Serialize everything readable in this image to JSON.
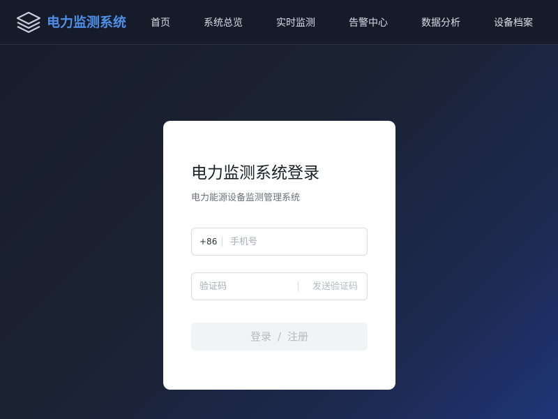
{
  "header": {
    "brand": "电力监测系统",
    "logo_icon": "stacked-layers-icon",
    "brand_color": "#4e8fe8",
    "nav": [
      {
        "label": "首页"
      },
      {
        "label": "系统总览"
      },
      {
        "label": "实时监测"
      },
      {
        "label": "告警中心"
      },
      {
        "label": "数据分析"
      },
      {
        "label": "设备档案"
      }
    ]
  },
  "login": {
    "title": "电力监测系统登录",
    "subtitle": "电力能源设备监测管理系统",
    "phone": {
      "prefix": "+86",
      "value": "",
      "placeholder": "手机号"
    },
    "code": {
      "value": "",
      "placeholder": "验证码",
      "send_label": "发送验证码"
    },
    "submit": {
      "login_label": "登录",
      "separator": "/",
      "register_label": "注册"
    }
  }
}
